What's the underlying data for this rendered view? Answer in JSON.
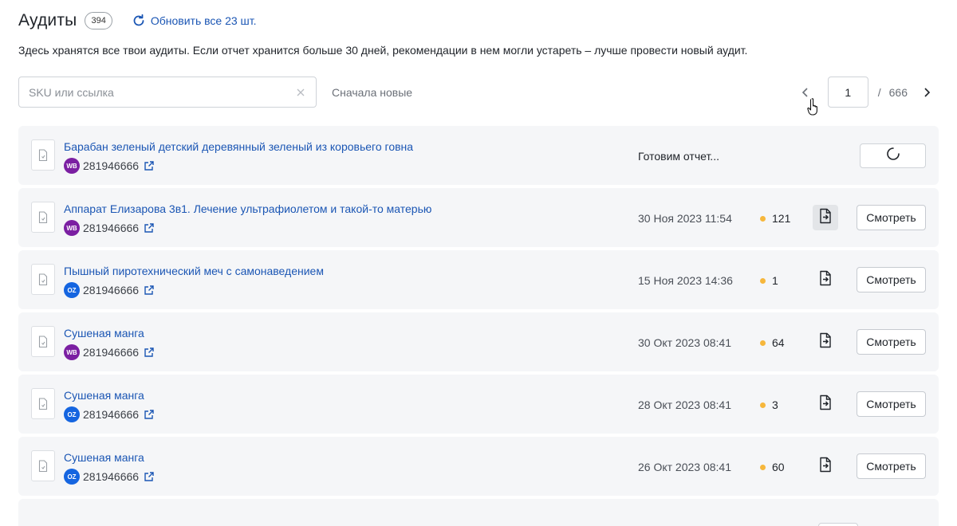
{
  "header": {
    "title": "Аудиты",
    "count": "394",
    "refresh_label": "Обновить все 23 шт."
  },
  "description": "Здесь хранятся все твои аудиты. Если отчет хранится больше 30 дней, рекомендации в нем могли устареть – лучше провести новый аудит.",
  "search": {
    "placeholder": "SKU или ссылка",
    "value": ""
  },
  "sort": {
    "label": "Сначала новые"
  },
  "pagination": {
    "current": "1",
    "separator": "/",
    "total": "666"
  },
  "colors": {
    "accent": "#1b56b4",
    "wb": "#7b1fa2",
    "oz": "#1565e0",
    "dot": "#f6b73c"
  },
  "audits": [
    {
      "title": "Барабан зеленый детский деревянный зеленый из коровьего говна",
      "marketplace": "WB",
      "sku": "281946666",
      "status": "Готовим отчет...",
      "loading": true
    },
    {
      "title": "Аппарат Елизарова 3в1. Лечение ультрафиолетом и такой-то матерью",
      "marketplace": "WB",
      "sku": "281946666",
      "date": "30 Ноя 2023  11:54",
      "issues": "121",
      "view_label": "Смотреть",
      "hover": true
    },
    {
      "title": "Пышный пиротехнический меч с самонаведением",
      "marketplace": "OZ",
      "sku": "281946666",
      "date": "15 Ноя 2023  14:36",
      "issues": "1",
      "view_label": "Смотреть"
    },
    {
      "title": "Сушеная манга",
      "marketplace": "WB",
      "sku": "281946666",
      "date": "30 Окт 2023   08:41",
      "issues": "64",
      "view_label": "Смотреть"
    },
    {
      "title": "Сушеная манга",
      "marketplace": "OZ",
      "sku": "281946666",
      "date": "28 Окт 2023   08:41",
      "issues": "3",
      "view_label": "Смотреть"
    },
    {
      "title": "Сушеная манга",
      "marketplace": "OZ",
      "sku": "281946666",
      "date": "26 Окт 2023   08:41",
      "issues": "60",
      "view_label": "Смотреть"
    }
  ]
}
